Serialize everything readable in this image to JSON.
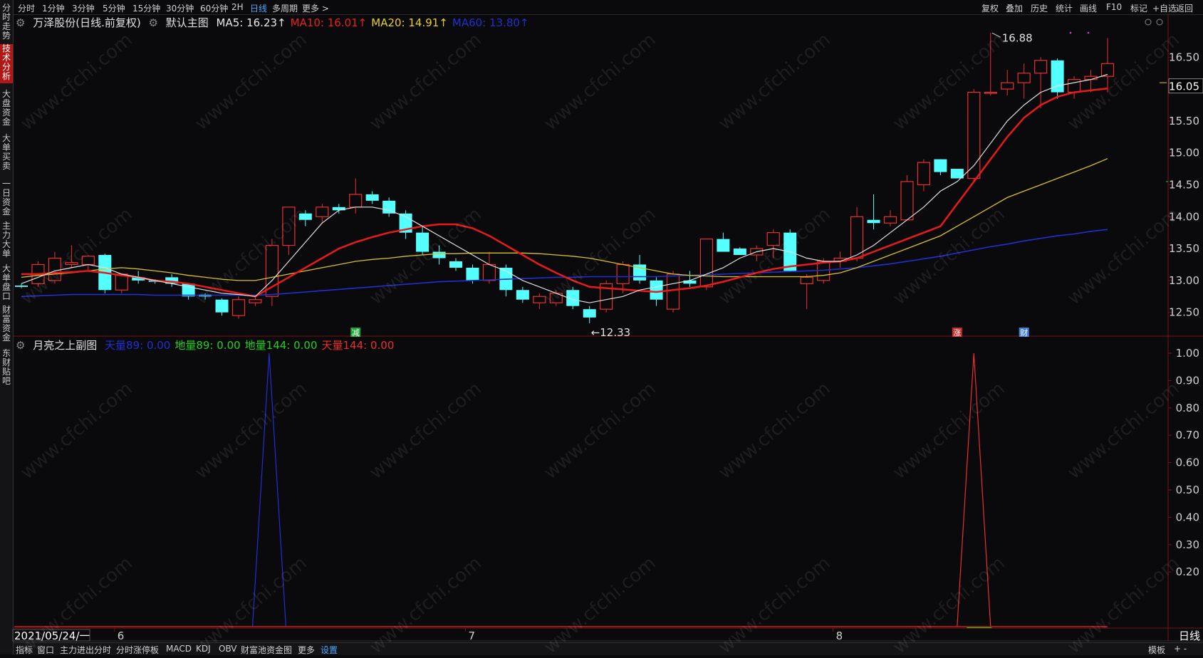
{
  "sidebar": {
    "items": [
      {
        "label": "分时走势",
        "active": false
      },
      {
        "label": "技术分析",
        "active": true
      },
      {
        "label": "大盘资金",
        "active": false
      },
      {
        "label": "大单买卖",
        "active": false
      },
      {
        "label": "一日资金",
        "active": false
      },
      {
        "label": "主力大单",
        "active": false
      },
      {
        "label": "大单盘口",
        "active": false
      },
      {
        "label": "财富资金",
        "active": false
      },
      {
        "label": "东财贴吧",
        "active": false
      }
    ]
  },
  "toolbar": {
    "periods": [
      "分时",
      "1分钟",
      "3分钟",
      "5分钟",
      "15分钟",
      "30分钟",
      "60分钟",
      "2H",
      "日线",
      "多周期",
      "更多 >"
    ],
    "active_period": "日线",
    "right": [
      "复权",
      "叠加",
      "历史",
      "统计",
      "画线",
      "F10",
      "标记",
      "+自选",
      "返回"
    ]
  },
  "main_chart": {
    "stock": "万泽股份(日线.前复权)",
    "template": "默认主图",
    "ma": [
      {
        "label": "MA5: 16.23↑",
        "color": "#e8e8e8"
      },
      {
        "label": "MA10: 16.01↑",
        "color": "#e82020"
      },
      {
        "label": "MA20: 14.91↑",
        "color": "#e8d020"
      },
      {
        "label": "MA60: 13.80↑",
        "color": "#2030d0"
      }
    ],
    "current_price": "16.05",
    "high_label": "16.88",
    "low_label": "12.33",
    "markers": [
      {
        "text": "减",
        "color": "#20c040",
        "index": 20
      },
      {
        "text": "涨",
        "color": "#e83030",
        "index": 56
      },
      {
        "text": "财",
        "color": "#4a90ff",
        "index": 60
      }
    ]
  },
  "sub_chart": {
    "name": "月亮之上副图",
    "values": [
      {
        "label": "天量89: 0.00",
        "color": "#2030d0"
      },
      {
        "label": "地量89: 0.00",
        "color": "#20d020"
      },
      {
        "label": "地量144: 0.00",
        "color": "#20d020"
      },
      {
        "label": "天量144: 0.00",
        "color": "#e83030"
      }
    ]
  },
  "chart_data": [
    {
      "type": "candlestick",
      "title": "万泽股份(日线.前复权)",
      "x_labels": [
        "6",
        "7",
        "8"
      ],
      "x_label_index": [
        6,
        27,
        49
      ],
      "date_label": "2021/05/24/一",
      "ylim": [
        12.15,
        16.95
      ],
      "yticks": [
        12.5,
        13.0,
        13.5,
        14.0,
        14.5,
        15.0,
        15.5,
        16.0,
        16.5
      ],
      "ohlc": [
        [
          12.92,
          12.95,
          12.88,
          12.9
        ],
        [
          12.95,
          13.3,
          12.9,
          13.25
        ],
        [
          13.0,
          13.45,
          12.95,
          13.35
        ],
        [
          13.25,
          13.55,
          13.2,
          13.28
        ],
        [
          13.25,
          13.4,
          13.15,
          13.38
        ],
        [
          13.4,
          13.42,
          12.8,
          12.85
        ],
        [
          12.85,
          13.1,
          12.8,
          13.1
        ],
        [
          13.05,
          13.15,
          12.95,
          13.0
        ],
        [
          13.0,
          13.02,
          12.95,
          12.98
        ],
        [
          13.05,
          13.1,
          12.9,
          12.95
        ],
        [
          12.95,
          12.95,
          12.7,
          12.75
        ],
        [
          12.78,
          12.8,
          12.7,
          12.75
        ],
        [
          12.7,
          12.72,
          12.45,
          12.5
        ],
        [
          12.45,
          12.75,
          12.4,
          12.7
        ],
        [
          12.65,
          12.75,
          12.6,
          12.7
        ],
        [
          12.75,
          13.65,
          12.6,
          13.55
        ],
        [
          13.55,
          14.15,
          13.4,
          14.15
        ],
        [
          14.05,
          14.1,
          13.85,
          13.95
        ],
        [
          14.0,
          14.2,
          13.9,
          14.15
        ],
        [
          14.15,
          14.2,
          14.05,
          14.1
        ],
        [
          14.15,
          14.6,
          14.05,
          14.35
        ],
        [
          14.35,
          14.4,
          14.2,
          14.25
        ],
        [
          14.25,
          14.3,
          14.0,
          14.05
        ],
        [
          14.05,
          14.1,
          13.65,
          13.75
        ],
        [
          13.75,
          13.85,
          13.4,
          13.45
        ],
        [
          13.45,
          13.55,
          13.25,
          13.35
        ],
        [
          13.3,
          13.35,
          13.15,
          13.2
        ],
        [
          13.2,
          13.25,
          12.95,
          13.0
        ],
        [
          13.0,
          13.45,
          12.95,
          13.25
        ],
        [
          13.2,
          13.25,
          12.75,
          12.85
        ],
        [
          12.85,
          12.9,
          12.65,
          12.7
        ],
        [
          12.65,
          12.8,
          12.55,
          12.75
        ],
        [
          12.65,
          12.85,
          12.6,
          12.8
        ],
        [
          12.85,
          12.9,
          12.55,
          12.6
        ],
        [
          12.55,
          12.6,
          12.33,
          12.42
        ],
        [
          12.55,
          13.0,
          12.5,
          12.95
        ],
        [
          12.95,
          13.3,
          12.8,
          13.25
        ],
        [
          13.25,
          13.4,
          12.95,
          13.0
        ],
        [
          13.0,
          13.05,
          12.6,
          12.7
        ],
        [
          12.55,
          13.15,
          12.5,
          13.1
        ],
        [
          13.0,
          13.15,
          12.9,
          12.95
        ],
        [
          12.9,
          13.65,
          12.85,
          13.65
        ],
        [
          13.65,
          13.75,
          13.45,
          13.45
        ],
        [
          13.5,
          13.52,
          13.4,
          13.4
        ],
        [
          13.4,
          13.55,
          13.3,
          13.5
        ],
        [
          13.55,
          13.8,
          13.35,
          13.75
        ],
        [
          13.75,
          13.8,
          13.15,
          13.15
        ],
        [
          12.95,
          13.1,
          12.55,
          13.05
        ],
        [
          13.0,
          13.35,
          12.95,
          13.3
        ],
        [
          13.3,
          13.45,
          13.2,
          13.35
        ],
        [
          13.35,
          14.15,
          13.3,
          14.0
        ],
        [
          13.95,
          14.35,
          13.8,
          13.9
        ],
        [
          13.9,
          14.1,
          13.85,
          14.0
        ],
        [
          13.95,
          14.65,
          13.95,
          14.55
        ],
        [
          14.5,
          14.9,
          14.4,
          14.85
        ],
        [
          14.9,
          14.9,
          14.65,
          14.7
        ],
        [
          14.75,
          14.75,
          14.6,
          14.6
        ],
        [
          14.6,
          16.0,
          14.55,
          15.95
        ],
        [
          15.95,
          16.88,
          15.9,
          15.95
        ],
        [
          16.0,
          16.3,
          15.9,
          16.1
        ],
        [
          16.1,
          16.4,
          15.85,
          16.25
        ],
        [
          16.25,
          16.5,
          15.7,
          16.45
        ],
        [
          16.45,
          16.48,
          15.85,
          15.95
        ],
        [
          15.95,
          16.2,
          15.85,
          16.15
        ],
        [
          16.15,
          16.3,
          15.95,
          16.2
        ],
        [
          16.2,
          16.8,
          15.95,
          16.4
        ]
      ],
      "ma": {
        "MA5": [
          12.95,
          13.05,
          13.15,
          13.2,
          13.25,
          13.2,
          13.1,
          13.05,
          13.0,
          12.95,
          12.9,
          12.85,
          12.8,
          12.78,
          12.75,
          13.0,
          13.3,
          13.6,
          13.9,
          14.1,
          14.15,
          14.15,
          14.1,
          14.0,
          13.85,
          13.7,
          13.55,
          13.4,
          13.25,
          13.15,
          13.0,
          12.9,
          12.8,
          12.7,
          12.65,
          12.7,
          12.75,
          12.85,
          12.9,
          12.95,
          13.0,
          13.1,
          13.2,
          13.35,
          13.45,
          13.5,
          13.45,
          13.35,
          13.3,
          13.3,
          13.4,
          13.55,
          13.75,
          13.95,
          14.15,
          14.4,
          14.55,
          14.8,
          15.15,
          15.5,
          15.75,
          15.95,
          16.05,
          16.1,
          16.15,
          16.23
        ],
        "MA10": [
          13.1,
          13.1,
          13.12,
          13.13,
          13.15,
          13.12,
          13.08,
          13.05,
          13.0,
          12.98,
          12.95,
          12.9,
          12.85,
          12.8,
          12.75,
          12.9,
          13.05,
          13.2,
          13.35,
          13.5,
          13.6,
          13.68,
          13.75,
          13.8,
          13.85,
          13.88,
          13.88,
          13.82,
          13.7,
          13.55,
          13.4,
          13.25,
          13.12,
          13.0,
          12.9,
          12.88,
          12.86,
          12.84,
          12.82,
          12.85,
          12.88,
          12.92,
          12.98,
          13.05,
          13.12,
          13.18,
          13.22,
          13.25,
          13.28,
          13.3,
          13.35,
          13.45,
          13.55,
          13.65,
          13.75,
          13.85,
          14.2,
          14.55,
          14.9,
          15.25,
          15.55,
          15.75,
          15.88,
          15.95,
          15.98,
          16.01
        ],
        "MA20": [
          13.05,
          13.08,
          13.1,
          13.12,
          13.15,
          13.18,
          13.2,
          13.18,
          13.15,
          13.12,
          13.08,
          13.05,
          13.02,
          13.0,
          13.0,
          13.05,
          13.1,
          13.15,
          13.2,
          13.25,
          13.3,
          13.33,
          13.35,
          13.38,
          13.4,
          13.42,
          13.42,
          13.43,
          13.43,
          13.43,
          13.43,
          13.42,
          13.4,
          13.38,
          13.35,
          13.3,
          13.25,
          13.2,
          13.15,
          13.1,
          13.08,
          13.07,
          13.06,
          13.06,
          13.06,
          13.06,
          13.06,
          13.06,
          13.08,
          13.12,
          13.2,
          13.3,
          13.4,
          13.5,
          13.6,
          13.7,
          13.85,
          14.0,
          14.15,
          14.3,
          14.4,
          14.5,
          14.6,
          14.7,
          14.8,
          14.91
        ],
        "MA60": [
          12.75,
          12.76,
          12.77,
          12.78,
          12.78,
          12.78,
          12.78,
          12.78,
          12.77,
          12.77,
          12.77,
          12.77,
          12.77,
          12.77,
          12.77,
          12.78,
          12.8,
          12.82,
          12.84,
          12.86,
          12.88,
          12.9,
          12.92,
          12.94,
          12.96,
          12.98,
          12.99,
          13.0,
          13.01,
          13.02,
          13.03,
          13.04,
          13.05,
          13.05,
          13.06,
          13.06,
          13.06,
          13.06,
          13.06,
          13.07,
          13.08,
          13.09,
          13.1,
          13.11,
          13.12,
          13.13,
          13.14,
          13.15,
          13.16,
          13.18,
          13.2,
          13.23,
          13.26,
          13.3,
          13.34,
          13.38,
          13.43,
          13.48,
          13.53,
          13.57,
          13.62,
          13.66,
          13.7,
          13.73,
          13.77,
          13.8
        ]
      }
    },
    {
      "type": "line",
      "title": "月亮之上副图",
      "ylim": [
        0,
        1.0
      ],
      "yticks": [
        0.2,
        0.3,
        0.4,
        0.5,
        0.6,
        0.7,
        0.8,
        0.9,
        1.0
      ],
      "series": [
        {
          "name": "天量89",
          "color": "#2030d0",
          "spike_index": 15,
          "values_peak": 1.0
        },
        {
          "name": "天量144",
          "color": "#e83030",
          "spike_index": 57,
          "values_peak": 1.0
        }
      ]
    }
  ]
}
